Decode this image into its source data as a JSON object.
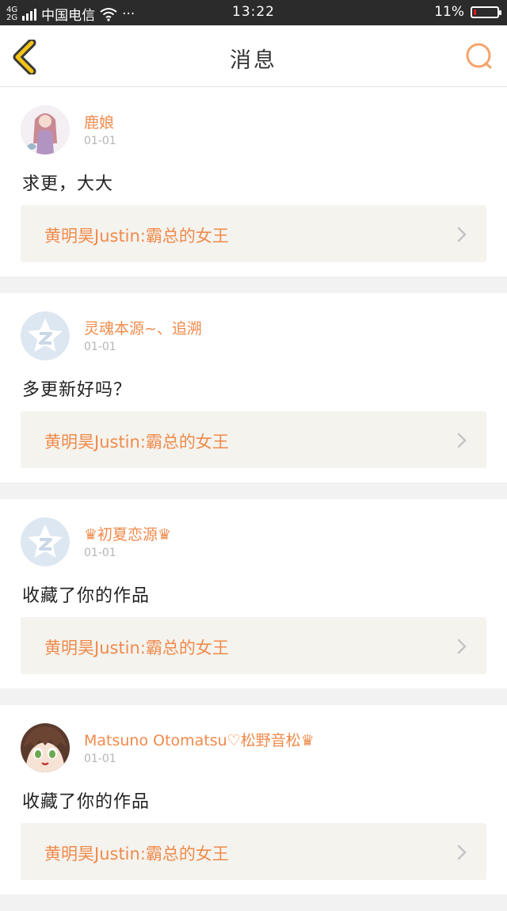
{
  "status_bar": {
    "network_top": "4G",
    "network_bottom": "2G",
    "carrier": "中国电信",
    "more": "···",
    "time": "13:22",
    "battery_level": "11%",
    "battery_fraction": 0.11,
    "battery_low_color": "#e0191e"
  },
  "nav": {
    "title": "消息",
    "back_icon": "chevron-left-icon",
    "search_icon": "search-icon",
    "back_color": "#f2c413",
    "search_color": "#f5a36b"
  },
  "accent_color": "#f08a4b",
  "messages": [
    {
      "username": "鹿娘",
      "date": "01-01",
      "text": "求更，大大",
      "work": "黄明昊Justin:霸总的女王",
      "avatar": "girl-avatar"
    },
    {
      "username": "灵魂本源~、追溯",
      "date": "01-01",
      "text": "多更新好吗？",
      "work": "黄明昊Justin:霸总的女王",
      "avatar": "default-avatar"
    },
    {
      "username": "♛初夏恋源♛",
      "date": "01-01",
      "text": "收藏了你的作品",
      "work": "黄明昊Justin:霸总的女王",
      "avatar": "default-avatar"
    },
    {
      "username": "Matsuno Otomatsu♡松野音松♛",
      "date": "01-01",
      "text": "收藏了你的作品",
      "work": "黄明昊Justin:霸总的女王",
      "avatar": "anime-avatar"
    }
  ]
}
